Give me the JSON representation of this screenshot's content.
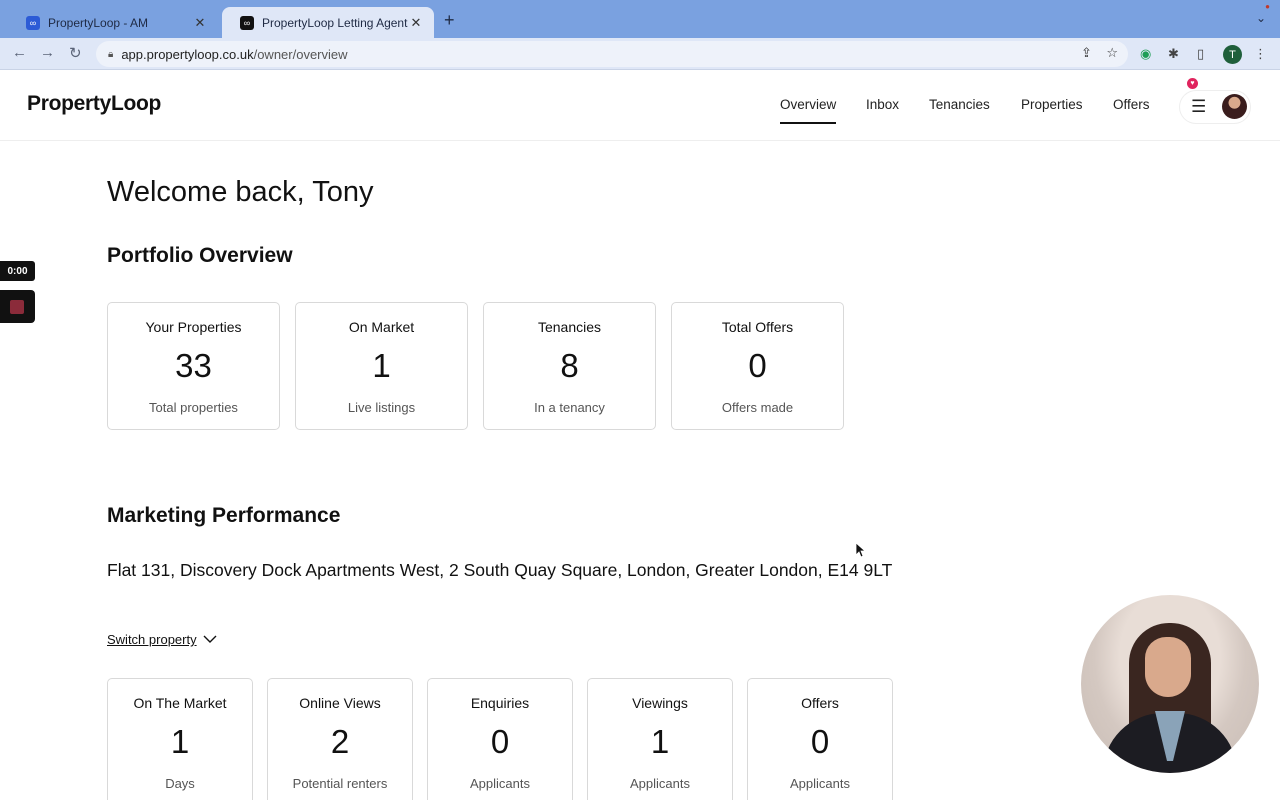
{
  "browser": {
    "tabs": [
      {
        "title": "PropertyLoop - AM",
        "favicon": "∞"
      },
      {
        "title": "PropertyLoop Letting Agents In",
        "favicon": "∞"
      }
    ],
    "url_domain": "app.propertyloop.co.uk",
    "url_path": "/owner/overview",
    "profile_initial": "T"
  },
  "header": {
    "logo": "PropertyLoop",
    "nav": [
      {
        "label": "Overview",
        "active": true
      },
      {
        "label": "Inbox",
        "active": false
      },
      {
        "label": "Tenancies",
        "active": false
      },
      {
        "label": "Properties",
        "active": false
      },
      {
        "label": "Offers",
        "active": false
      }
    ]
  },
  "main": {
    "welcome": "Welcome back, Tony",
    "portfolio": {
      "heading": "Portfolio Overview",
      "cards": [
        {
          "label": "Your Properties",
          "value": "33",
          "sub": "Total properties"
        },
        {
          "label": "On Market",
          "value": "1",
          "sub": "Live listings"
        },
        {
          "label": "Tenancies",
          "value": "8",
          "sub": "In a tenancy"
        },
        {
          "label": "Total Offers",
          "value": "0",
          "sub": "Offers made"
        }
      ]
    },
    "marketing": {
      "heading": "Marketing Performance",
      "address": "Flat 131, Discovery Dock Apartments West, 2 South Quay Square, London, Greater London, E14 9LT",
      "switch_label": "Switch property",
      "cards": [
        {
          "label": "On The Market",
          "value": "1",
          "sub": "Days"
        },
        {
          "label": "Online Views",
          "value": "2",
          "sub": "Potential renters"
        },
        {
          "label": "Enquiries",
          "value": "0",
          "sub": "Applicants"
        },
        {
          "label": "Viewings",
          "value": "1",
          "sub": "Applicants"
        },
        {
          "label": "Offers",
          "value": "0",
          "sub": "Applicants"
        }
      ]
    }
  },
  "recorder": {
    "time": "0:00"
  }
}
